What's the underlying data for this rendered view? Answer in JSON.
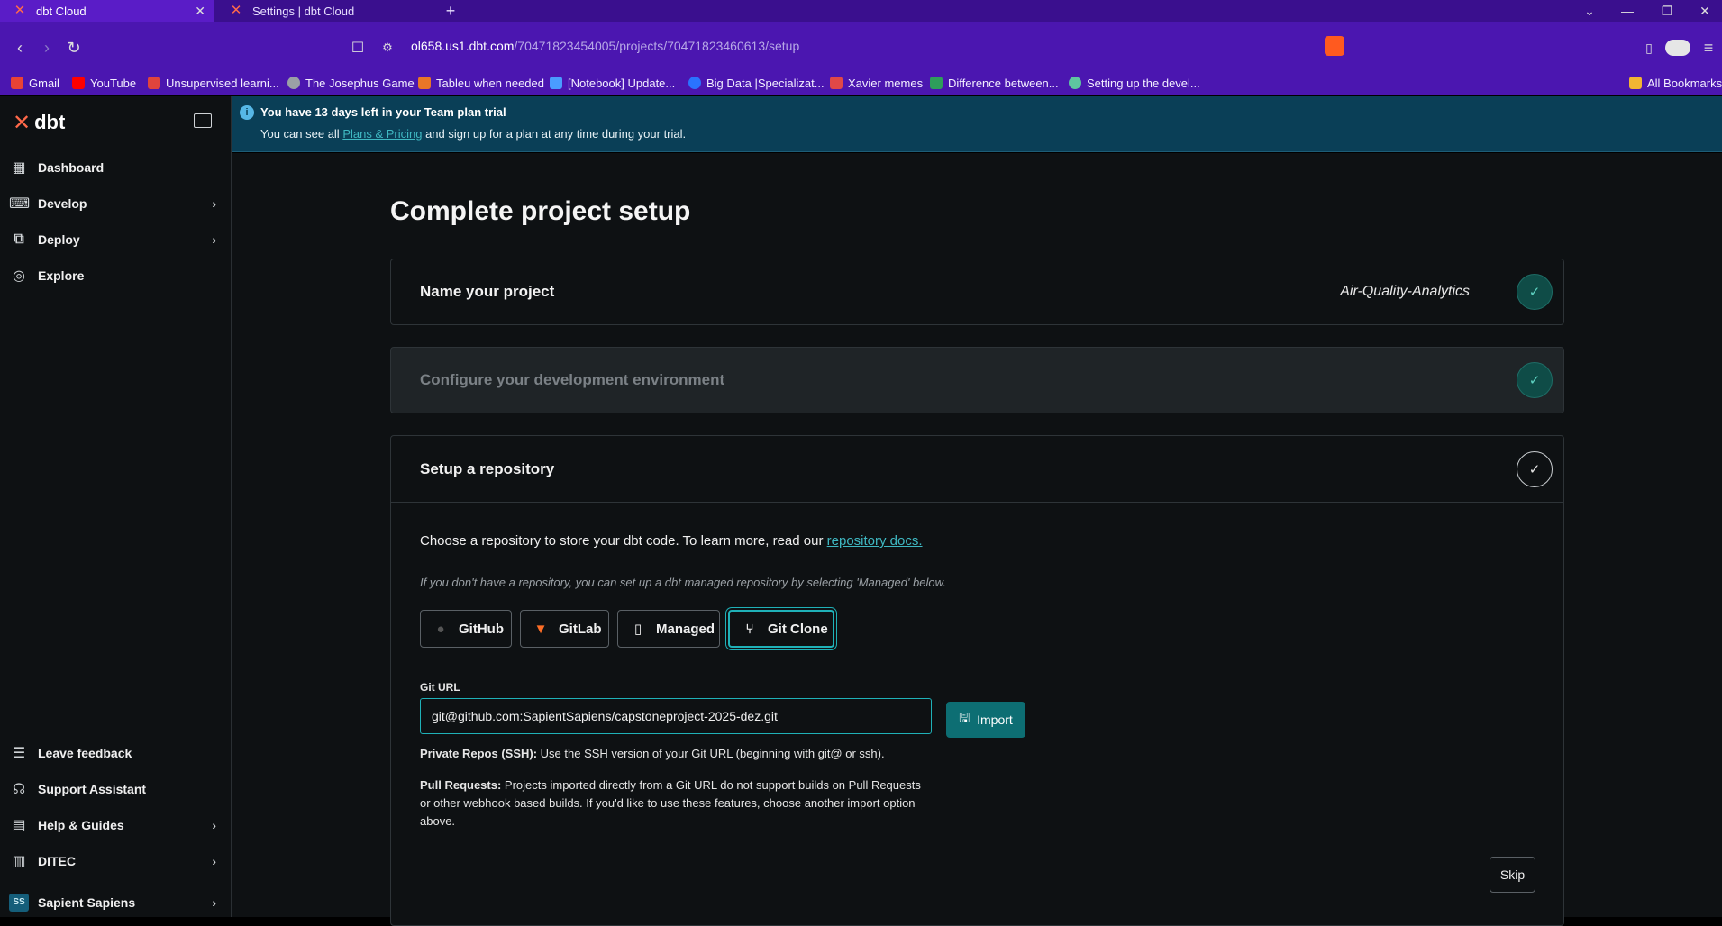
{
  "browser": {
    "tabs": [
      {
        "title": "dbt Cloud",
        "active": true
      },
      {
        "title": "Settings | dbt Cloud",
        "active": false
      }
    ],
    "new_tab": "+",
    "url_host": "ol658.us1.dbt.com",
    "url_path": "/70471823454005/projects/70471823460613/setup",
    "bookmarks": [
      {
        "label": "Gmail",
        "color": "#ea4335"
      },
      {
        "label": "YouTube",
        "color": "#ff0000"
      },
      {
        "label": "Unsupervised learni...",
        "color": "#e0443d"
      },
      {
        "label": "The Josephus Game",
        "color": "#9aa0a6"
      },
      {
        "label": "Tableu when needed",
        "color": "#e97627"
      },
      {
        "label": "[Notebook] Update...",
        "color": "#4a9cff"
      },
      {
        "label": "Big Data |Specializat...",
        "color": "#2a73ff"
      },
      {
        "label": "Xavier memes",
        "color": "#e04848"
      },
      {
        "label": "Difference between...",
        "color": "#2e9e5b"
      },
      {
        "label": "Setting up the devel...",
        "color": "#5ec6a0"
      }
    ],
    "all_bookmarks": "All Bookmarks"
  },
  "sidebar": {
    "brand": "dbt",
    "items": [
      {
        "label": "Dashboard",
        "icon": "dashboard-icon"
      },
      {
        "label": "Develop",
        "icon": "code-icon"
      },
      {
        "label": "Deploy",
        "icon": "deploy-icon"
      },
      {
        "label": "Explore",
        "icon": "explore-icon"
      }
    ],
    "bottom_items": [
      {
        "label": "Leave feedback",
        "icon": "feedback-icon"
      },
      {
        "label": "Support Assistant",
        "icon": "headset-icon"
      },
      {
        "label": "Help & Guides",
        "icon": "book-icon"
      },
      {
        "label": "DITEC",
        "icon": "building-icon"
      },
      {
        "label": "Sapient Sapiens",
        "icon": "avatar"
      }
    ],
    "avatar_initials": "SS"
  },
  "banner": {
    "title": "You have 13 days left in your Team plan trial",
    "text_before": "You can see all ",
    "link": "Plans & Pricing",
    "text_after": " and sign up for a plan at any time during your trial."
  },
  "page": {
    "title": "Complete project setup",
    "step1": {
      "title": "Name your project",
      "value": "Air-Quality-Analytics"
    },
    "step2": {
      "title": "Configure your development environment"
    },
    "step3": {
      "title": "Setup a repository",
      "intro": "Choose a repository to store your dbt code. To learn more, read our ",
      "intro_link": "repository docs.",
      "hint": "If you don't have a repository, you can set up a dbt managed repository by selecting 'Managed' below.",
      "options": [
        "GitHub",
        "GitLab",
        "Managed",
        "Git Clone"
      ],
      "selected_option": "Git Clone",
      "git_url_label": "Git URL",
      "git_url_value": "git@github.com:SapientSapiens/capstoneproject-2025-dez.git",
      "import_label": "Import",
      "private_title": "Private Repos (SSH):",
      "private_text": " Use the SSH version of your Git URL (beginning with git@ or ssh).",
      "pull_title": "Pull Requests:",
      "pull_text": " Projects imported directly from a Git URL do not support builds on Pull Requests or other webhook based builds. If you'd like to use these features, choose another import option above.",
      "skip_label": "Skip"
    }
  },
  "colors": {
    "accent": "#1fb1b8",
    "brand": "#ff694a",
    "banner_bg": "#0a3f57",
    "done_check": "#0f4c47"
  }
}
